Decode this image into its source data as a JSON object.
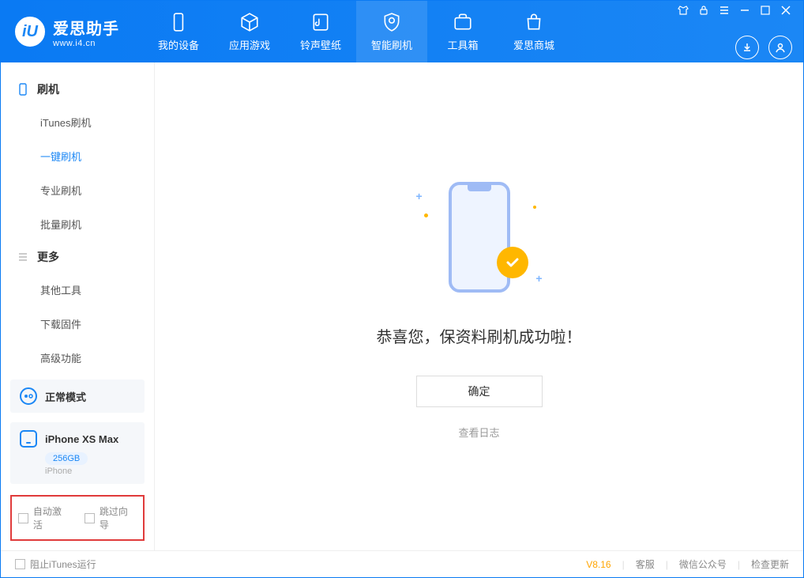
{
  "logo": {
    "title": "爱思助手",
    "url": "www.i4.cn",
    "mark": "iU"
  },
  "nav": {
    "device": "我的设备",
    "apps": "应用游戏",
    "ringtones": "铃声壁纸",
    "flash": "智能刷机",
    "toolbox": "工具箱",
    "mall": "爱思商城"
  },
  "sidebar": {
    "flash_header": "刷机",
    "itunes_flash": "iTunes刷机",
    "oneclick_flash": "一键刷机",
    "pro_flash": "专业刷机",
    "batch_flash": "批量刷机",
    "more_header": "更多",
    "other_tools": "其他工具",
    "download_fw": "下载固件",
    "advanced": "高级功能",
    "mode_label": "正常模式",
    "device_name": "iPhone XS Max",
    "storage": "256GB",
    "device_type": "iPhone",
    "auto_activate": "自动激活",
    "skip_guide": "跳过向导"
  },
  "main": {
    "success_msg": "恭喜您，保资料刷机成功啦！",
    "ok_btn": "确定",
    "log_link": "查看日志"
  },
  "status": {
    "block_itunes": "阻止iTunes运行",
    "version": "V8.16",
    "support": "客服",
    "wechat": "微信公众号",
    "update": "检查更新"
  }
}
